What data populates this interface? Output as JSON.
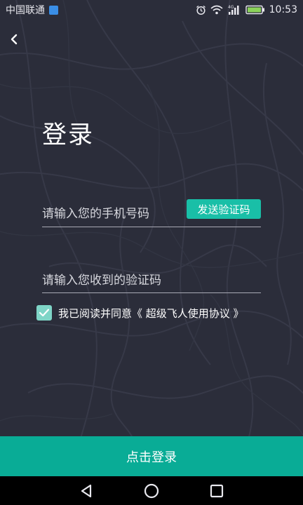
{
  "status_bar": {
    "carrier": "中国联通",
    "network_type": "4G",
    "time": "10:53",
    "icons": [
      "carrier-badge-icon",
      "alarm-icon",
      "wifi-icon",
      "signal-icon",
      "battery-icon"
    ]
  },
  "header": {
    "back_icon": "chevron-left-icon"
  },
  "main": {
    "title": "登录",
    "phone_placeholder": "请输入您的手机号码",
    "send_code_label": "发送验证码",
    "code_placeholder": "请输入您收到的验证码",
    "agree_checked": true,
    "agree_text": "我已阅读并同意《 超级飞人使用协议 》"
  },
  "footer": {
    "login_label": "点击登录"
  },
  "nav_bar": {
    "icons": [
      "back-triangle-icon",
      "home-circle-icon",
      "recents-square-icon"
    ]
  },
  "colors": {
    "background": "#2b2d3a",
    "accent": "#19bfa7",
    "login_button": "#09ac96",
    "checkbox": "#7fd5c7"
  }
}
